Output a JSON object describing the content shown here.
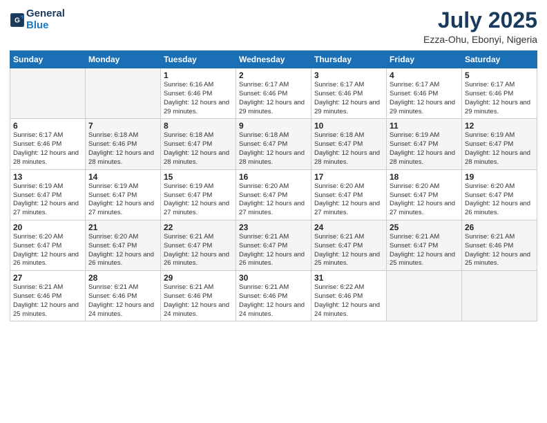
{
  "logo": {
    "line1": "General",
    "line2": "Blue"
  },
  "title": "July 2025",
  "subtitle": "Ezza-Ohu, Ebonyi, Nigeria",
  "weekdays": [
    "Sunday",
    "Monday",
    "Tuesday",
    "Wednesday",
    "Thursday",
    "Friday",
    "Saturday"
  ],
  "weeks": [
    [
      {
        "day": "",
        "sunrise": "",
        "sunset": "",
        "daylight": ""
      },
      {
        "day": "",
        "sunrise": "",
        "sunset": "",
        "daylight": ""
      },
      {
        "day": "1",
        "sunrise": "Sunrise: 6:16 AM",
        "sunset": "Sunset: 6:46 PM",
        "daylight": "Daylight: 12 hours and 29 minutes."
      },
      {
        "day": "2",
        "sunrise": "Sunrise: 6:17 AM",
        "sunset": "Sunset: 6:46 PM",
        "daylight": "Daylight: 12 hours and 29 minutes."
      },
      {
        "day": "3",
        "sunrise": "Sunrise: 6:17 AM",
        "sunset": "Sunset: 6:46 PM",
        "daylight": "Daylight: 12 hours and 29 minutes."
      },
      {
        "day": "4",
        "sunrise": "Sunrise: 6:17 AM",
        "sunset": "Sunset: 6:46 PM",
        "daylight": "Daylight: 12 hours and 29 minutes."
      },
      {
        "day": "5",
        "sunrise": "Sunrise: 6:17 AM",
        "sunset": "Sunset: 6:46 PM",
        "daylight": "Daylight: 12 hours and 29 minutes."
      }
    ],
    [
      {
        "day": "6",
        "sunrise": "Sunrise: 6:17 AM",
        "sunset": "Sunset: 6:46 PM",
        "daylight": "Daylight: 12 hours and 28 minutes."
      },
      {
        "day": "7",
        "sunrise": "Sunrise: 6:18 AM",
        "sunset": "Sunset: 6:46 PM",
        "daylight": "Daylight: 12 hours and 28 minutes."
      },
      {
        "day": "8",
        "sunrise": "Sunrise: 6:18 AM",
        "sunset": "Sunset: 6:47 PM",
        "daylight": "Daylight: 12 hours and 28 minutes."
      },
      {
        "day": "9",
        "sunrise": "Sunrise: 6:18 AM",
        "sunset": "Sunset: 6:47 PM",
        "daylight": "Daylight: 12 hours and 28 minutes."
      },
      {
        "day": "10",
        "sunrise": "Sunrise: 6:18 AM",
        "sunset": "Sunset: 6:47 PM",
        "daylight": "Daylight: 12 hours and 28 minutes."
      },
      {
        "day": "11",
        "sunrise": "Sunrise: 6:19 AM",
        "sunset": "Sunset: 6:47 PM",
        "daylight": "Daylight: 12 hours and 28 minutes."
      },
      {
        "day": "12",
        "sunrise": "Sunrise: 6:19 AM",
        "sunset": "Sunset: 6:47 PM",
        "daylight": "Daylight: 12 hours and 28 minutes."
      }
    ],
    [
      {
        "day": "13",
        "sunrise": "Sunrise: 6:19 AM",
        "sunset": "Sunset: 6:47 PM",
        "daylight": "Daylight: 12 hours and 27 minutes."
      },
      {
        "day": "14",
        "sunrise": "Sunrise: 6:19 AM",
        "sunset": "Sunset: 6:47 PM",
        "daylight": "Daylight: 12 hours and 27 minutes."
      },
      {
        "day": "15",
        "sunrise": "Sunrise: 6:19 AM",
        "sunset": "Sunset: 6:47 PM",
        "daylight": "Daylight: 12 hours and 27 minutes."
      },
      {
        "day": "16",
        "sunrise": "Sunrise: 6:20 AM",
        "sunset": "Sunset: 6:47 PM",
        "daylight": "Daylight: 12 hours and 27 minutes."
      },
      {
        "day": "17",
        "sunrise": "Sunrise: 6:20 AM",
        "sunset": "Sunset: 6:47 PM",
        "daylight": "Daylight: 12 hours and 27 minutes."
      },
      {
        "day": "18",
        "sunrise": "Sunrise: 6:20 AM",
        "sunset": "Sunset: 6:47 PM",
        "daylight": "Daylight: 12 hours and 27 minutes."
      },
      {
        "day": "19",
        "sunrise": "Sunrise: 6:20 AM",
        "sunset": "Sunset: 6:47 PM",
        "daylight": "Daylight: 12 hours and 26 minutes."
      }
    ],
    [
      {
        "day": "20",
        "sunrise": "Sunrise: 6:20 AM",
        "sunset": "Sunset: 6:47 PM",
        "daylight": "Daylight: 12 hours and 26 minutes."
      },
      {
        "day": "21",
        "sunrise": "Sunrise: 6:20 AM",
        "sunset": "Sunset: 6:47 PM",
        "daylight": "Daylight: 12 hours and 26 minutes."
      },
      {
        "day": "22",
        "sunrise": "Sunrise: 6:21 AM",
        "sunset": "Sunset: 6:47 PM",
        "daylight": "Daylight: 12 hours and 26 minutes."
      },
      {
        "day": "23",
        "sunrise": "Sunrise: 6:21 AM",
        "sunset": "Sunset: 6:47 PM",
        "daylight": "Daylight: 12 hours and 26 minutes."
      },
      {
        "day": "24",
        "sunrise": "Sunrise: 6:21 AM",
        "sunset": "Sunset: 6:47 PM",
        "daylight": "Daylight: 12 hours and 25 minutes."
      },
      {
        "day": "25",
        "sunrise": "Sunrise: 6:21 AM",
        "sunset": "Sunset: 6:47 PM",
        "daylight": "Daylight: 12 hours and 25 minutes."
      },
      {
        "day": "26",
        "sunrise": "Sunrise: 6:21 AM",
        "sunset": "Sunset: 6:46 PM",
        "daylight": "Daylight: 12 hours and 25 minutes."
      }
    ],
    [
      {
        "day": "27",
        "sunrise": "Sunrise: 6:21 AM",
        "sunset": "Sunset: 6:46 PM",
        "daylight": "Daylight: 12 hours and 25 minutes."
      },
      {
        "day": "28",
        "sunrise": "Sunrise: 6:21 AM",
        "sunset": "Sunset: 6:46 PM",
        "daylight": "Daylight: 12 hours and 24 minutes."
      },
      {
        "day": "29",
        "sunrise": "Sunrise: 6:21 AM",
        "sunset": "Sunset: 6:46 PM",
        "daylight": "Daylight: 12 hours and 24 minutes."
      },
      {
        "day": "30",
        "sunrise": "Sunrise: 6:21 AM",
        "sunset": "Sunset: 6:46 PM",
        "daylight": "Daylight: 12 hours and 24 minutes."
      },
      {
        "day": "31",
        "sunrise": "Sunrise: 6:22 AM",
        "sunset": "Sunset: 6:46 PM",
        "daylight": "Daylight: 12 hours and 24 minutes."
      },
      {
        "day": "",
        "sunrise": "",
        "sunset": "",
        "daylight": ""
      },
      {
        "day": "",
        "sunrise": "",
        "sunset": "",
        "daylight": ""
      }
    ]
  ]
}
